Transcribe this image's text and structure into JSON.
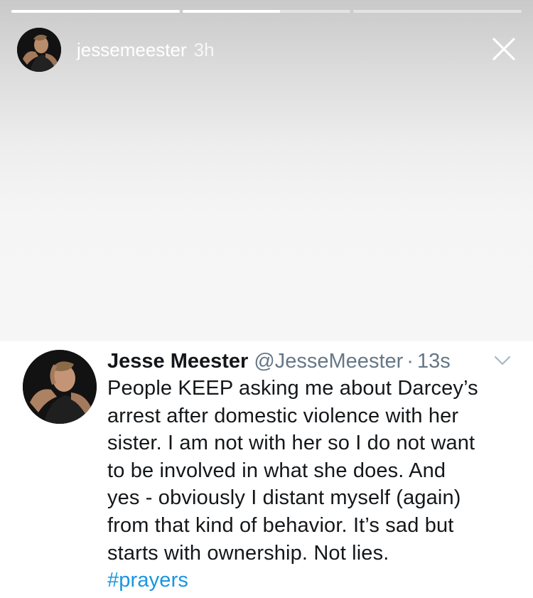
{
  "story": {
    "progress": [
      1.0,
      0.58,
      0.0
    ],
    "username": "jessemeester",
    "time": "3h"
  },
  "tweet": {
    "name": "Jesse Meester",
    "handle": "@JesseMeester",
    "separator": "·",
    "time": "13s",
    "lines": [
      "People KEEP asking me about Darcey’s",
      "arrest after domestic violence with her",
      "sister. I am not with her so I do not want",
      "to be involved in what she does. And",
      "yes - obviously I distant myself (again)",
      "from that kind of behavior. It’s sad but",
      "starts with ownership. Not lies."
    ],
    "hashtag": "#prayers"
  },
  "colors": {
    "link": "#1b95e0",
    "secondary_text": "#657786",
    "primary_text": "#14171a"
  },
  "icons": [
    "close-icon",
    "chevron-down-icon",
    "avatar"
  ]
}
